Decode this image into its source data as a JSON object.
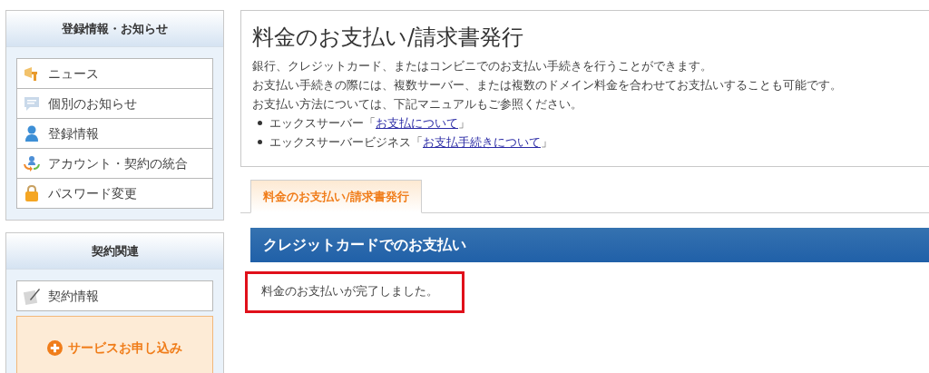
{
  "sidebar": {
    "panels": [
      {
        "title": "登録情報・お知らせ",
        "items": [
          {
            "label": "ニュース"
          },
          {
            "label": "個別のお知らせ"
          },
          {
            "label": "登録情報"
          },
          {
            "label": "アカウント・契約の統合"
          },
          {
            "label": "パスワード変更"
          }
        ]
      },
      {
        "title": "契約関連",
        "items": [
          {
            "label": "契約情報"
          }
        ],
        "action": "サービスお申し込み"
      }
    ]
  },
  "intro": {
    "title": "料金のお支払い/請求書発行",
    "paragraphs": [
      "銀行、クレジットカード、またはコンビニでのお支払い手続きを行うことができます。",
      "お支払い手続きの際には、複数サーバー、または複数のドメイン料金を合わせてお支払いすることも可能です。",
      "お支払い方法については、下記マニュアルもご参照ください。"
    ],
    "links": [
      {
        "prefix": "エックスサーバー「",
        "link": "お支払について",
        "suffix": "」"
      },
      {
        "prefix": "エックスサーバービジネス「",
        "link": "お支払手続きについて",
        "suffix": "」"
      }
    ]
  },
  "tabs": [
    {
      "label": "料金のお支払い/請求書発行",
      "selected": true
    }
  ],
  "section": {
    "title": "クレジットカードでのお支払い",
    "message": "料金のお支払いが完了しました。",
    "highlighted": true
  }
}
